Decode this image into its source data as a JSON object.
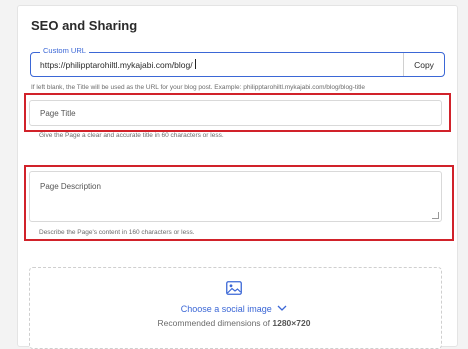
{
  "section": {
    "title": "SEO and Sharing"
  },
  "custom_url": {
    "label": "Custom URL",
    "value": "https://philipptarohiltl.mykajabi.com/blog/",
    "copy_label": "Copy",
    "help": "If left blank, the Title will be used as the URL for your blog post. Example: philipptarohiltl.mykajabi.com/blog/blog-title"
  },
  "page_title": {
    "placeholder": "Page Title",
    "help": "Give the Page a clear and accurate title in 60 characters or less."
  },
  "page_description": {
    "placeholder": "Page Description",
    "help": "Describe the Page's content in 160 characters or less."
  },
  "social_image": {
    "choose_label": "Choose a social image",
    "dims_prefix": "Recommended dimensions of",
    "dims_value": "1280×720",
    "icon": "image-icon"
  },
  "colors": {
    "accent": "#3b67d6",
    "highlight": "#d1222a"
  }
}
